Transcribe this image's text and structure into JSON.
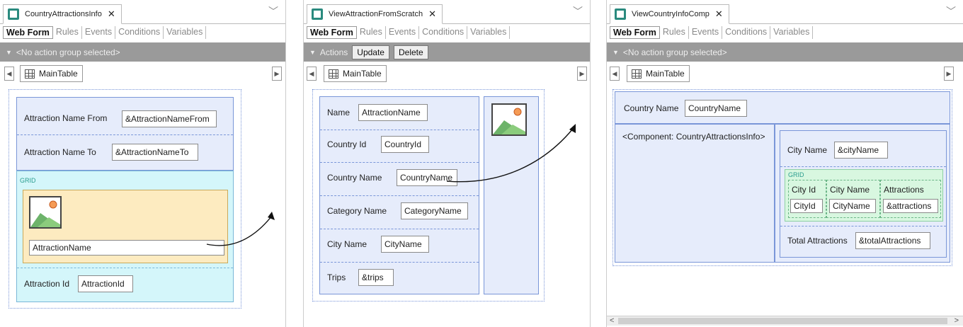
{
  "panels": [
    {
      "tab_title": "CountryAttractionsInfo",
      "subtabs": [
        "Web Form",
        "Rules",
        "Events",
        "Conditions",
        "Variables"
      ],
      "action_text": "<No action group selected>",
      "maintable": "MainTable",
      "attr_from_label": "Attraction Name From",
      "attr_from_value": "&AttractionNameFrom",
      "attr_to_label": "Attraction Name To",
      "attr_to_value": "&AttractionNameTo",
      "grid_caption": "GRID",
      "grid_field": "AttractionName",
      "attr_id_label": "Attraction Id",
      "attr_id_value": "AttractionId"
    },
    {
      "tab_title": "ViewAttractionFromScratch",
      "subtabs": [
        "Web Form",
        "Rules",
        "Events",
        "Conditions",
        "Variables"
      ],
      "action_text": "Actions",
      "actions": [
        "Update",
        "Delete"
      ],
      "maintable": "MainTable",
      "rows": [
        {
          "label": "Name",
          "value": "AttractionName"
        },
        {
          "label": "Country Id",
          "value": "CountryId"
        },
        {
          "label": "Country Name",
          "value": "CountryName"
        },
        {
          "label": "Category Name",
          "value": "CategoryName"
        },
        {
          "label": "City Name",
          "value": "CityName"
        },
        {
          "label": "Trips",
          "value": "&trips"
        }
      ]
    },
    {
      "tab_title": "ViewCountryInfoComp",
      "subtabs": [
        "Web Form",
        "Rules",
        "Events",
        "Conditions",
        "Variables"
      ],
      "action_text": "<No action group selected>",
      "maintable": "MainTable",
      "country_label": "Country Name",
      "country_value": "CountryName",
      "component": "<Component: CountryAttractionsInfo>",
      "city_label": "City Name",
      "city_value": "&cityName",
      "grid_caption": "GRID",
      "grid_headers": [
        "City Id",
        "City Name",
        "Attractions"
      ],
      "grid_values": [
        "CityId",
        "CityName",
        "&attractions"
      ],
      "total_label": "Total Attractions",
      "total_value": "&totalAttractions"
    }
  ],
  "icons": {
    "tab": "webform-icon",
    "close": "close-icon",
    "chevron": "chevron-down-icon",
    "grid": "table-icon",
    "image": "image-placeholder-icon"
  }
}
